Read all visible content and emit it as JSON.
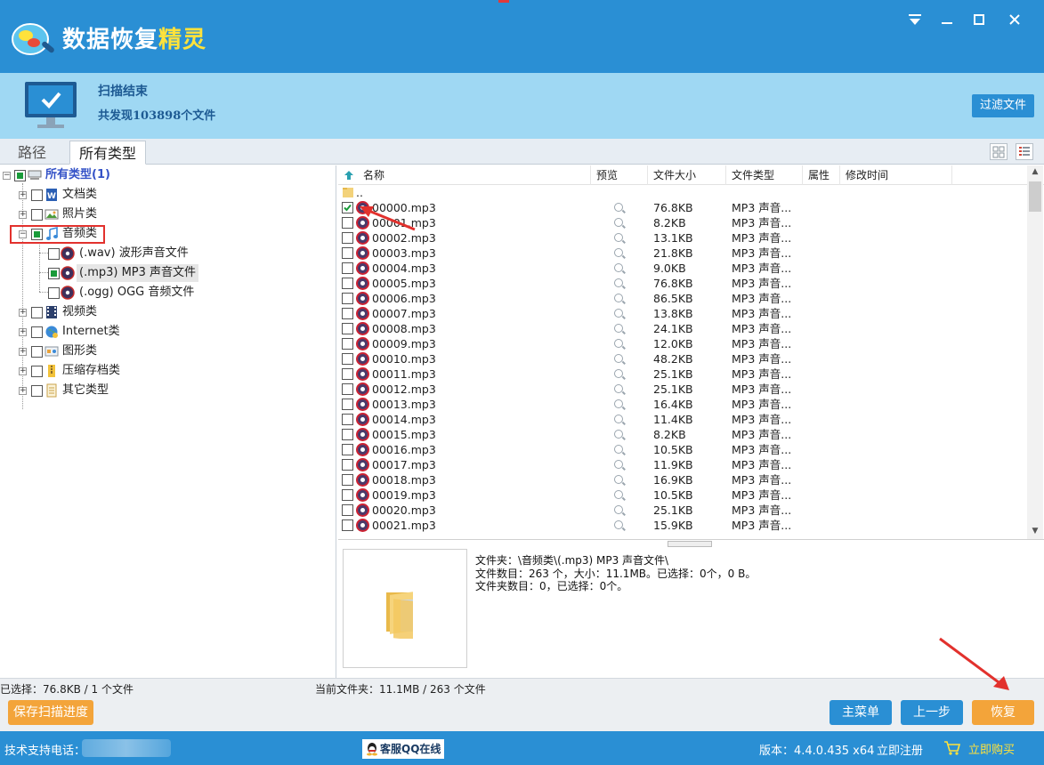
{
  "title_bar": {
    "title_main": "数据恢复",
    "title_accent": "精灵",
    "menu_icon": "menu-dropdown-icon",
    "minimize_icon": "minimize-icon",
    "maximize_icon": "maximize-icon",
    "close_icon": "close-icon"
  },
  "status": {
    "title": "扫描结束",
    "count_text": "共发现103898个文件",
    "filter_label": "过滤文件"
  },
  "tabs": [
    {
      "label": "路径",
      "active": false
    },
    {
      "label": "所有类型",
      "active": true
    }
  ],
  "tree": {
    "root": "所有类型(1)",
    "items": [
      {
        "label": "文档类",
        "icon": "word-doc-icon"
      },
      {
        "label": "照片类",
        "icon": "photo-icon"
      },
      {
        "label": "音频类",
        "icon": "music-note-icon",
        "expanded": true
      },
      {
        "label": "视频类",
        "icon": "film-icon"
      },
      {
        "label": "Internet类",
        "icon": "globe-icon"
      },
      {
        "label": "图形类",
        "icon": "graphics-icon"
      },
      {
        "label": "压缩存档类",
        "icon": "archive-icon"
      },
      {
        "label": "其它类型",
        "icon": "other-file-icon"
      }
    ],
    "audio_children": [
      {
        "label": "(.wav) 波形声音文件"
      },
      {
        "label": "(.mp3) MP3 声音文件",
        "selected": true
      },
      {
        "label": "(.ogg) OGG 音频文件"
      }
    ]
  },
  "list": {
    "headers": {
      "name": "名称",
      "preview": "预览",
      "size": "文件大小",
      "type": "文件类型",
      "attr": "属性",
      "mtime": "修改时间"
    },
    "parent_dir": "..",
    "rows": [
      {
        "name": "00000.mp3",
        "size": "76.8KB",
        "type": "MP3 声音...",
        "checked": true
      },
      {
        "name": "00001.mp3",
        "size": "8.2KB",
        "type": "MP3 声音..."
      },
      {
        "name": "00002.mp3",
        "size": "13.1KB",
        "type": "MP3 声音..."
      },
      {
        "name": "00003.mp3",
        "size": "21.8KB",
        "type": "MP3 声音..."
      },
      {
        "name": "00004.mp3",
        "size": "9.0KB",
        "type": "MP3 声音..."
      },
      {
        "name": "00005.mp3",
        "size": "76.8KB",
        "type": "MP3 声音..."
      },
      {
        "name": "00006.mp3",
        "size": "86.5KB",
        "type": "MP3 声音..."
      },
      {
        "name": "00007.mp3",
        "size": "13.8KB",
        "type": "MP3 声音..."
      },
      {
        "name": "00008.mp3",
        "size": "24.1KB",
        "type": "MP3 声音..."
      },
      {
        "name": "00009.mp3",
        "size": "12.0KB",
        "type": "MP3 声音..."
      },
      {
        "name": "00010.mp3",
        "size": "48.2KB",
        "type": "MP3 声音..."
      },
      {
        "name": "00011.mp3",
        "size": "25.1KB",
        "type": "MP3 声音..."
      },
      {
        "name": "00012.mp3",
        "size": "25.1KB",
        "type": "MP3 声音..."
      },
      {
        "name": "00013.mp3",
        "size": "16.4KB",
        "type": "MP3 声音..."
      },
      {
        "name": "00014.mp3",
        "size": "11.4KB",
        "type": "MP3 声音..."
      },
      {
        "name": "00015.mp3",
        "size": "8.2KB",
        "type": "MP3 声音..."
      },
      {
        "name": "00016.mp3",
        "size": "10.5KB",
        "type": "MP3 声音..."
      },
      {
        "name": "00017.mp3",
        "size": "11.9KB",
        "type": "MP3 声音..."
      },
      {
        "name": "00018.mp3",
        "size": "16.9KB",
        "type": "MP3 声音..."
      },
      {
        "name": "00019.mp3",
        "size": "10.5KB",
        "type": "MP3 声音..."
      },
      {
        "name": "00020.mp3",
        "size": "25.1KB",
        "type": "MP3 声音..."
      },
      {
        "name": "00021.mp3",
        "size": "15.9KB",
        "type": "MP3 声音..."
      }
    ]
  },
  "detail": {
    "folder_line": "文件夹：\\音频类\\(.mp3) MP3 声音文件\\",
    "files_line": "文件数目：263 个，大小：11.1MB。已选择：0个，0 B。",
    "folders_line": "文件夹数目：0，已选择：0个。"
  },
  "bottom": {
    "selected_info": "已选择：76.8KB / 1 个文件",
    "current_info": "当前文件夹：11.1MB / 263 个文件",
    "save_progress": "保存扫描进度",
    "main_menu": "主菜单",
    "back": "上一步",
    "recover": "恢复"
  },
  "footer": {
    "support_label": "技术支持电话：",
    "qq_label": "客服QQ在线",
    "version": "版本：4.4.0.435 x64",
    "register": "立即注册",
    "buy": "立即购买"
  },
  "colors": {
    "brand_blue": "#2a8fd4",
    "status_blue": "#9fd8f3",
    "accent_yellow": "#ffe23b",
    "button_orange": "#f3a43a",
    "annotation_red": "#e2312d"
  }
}
